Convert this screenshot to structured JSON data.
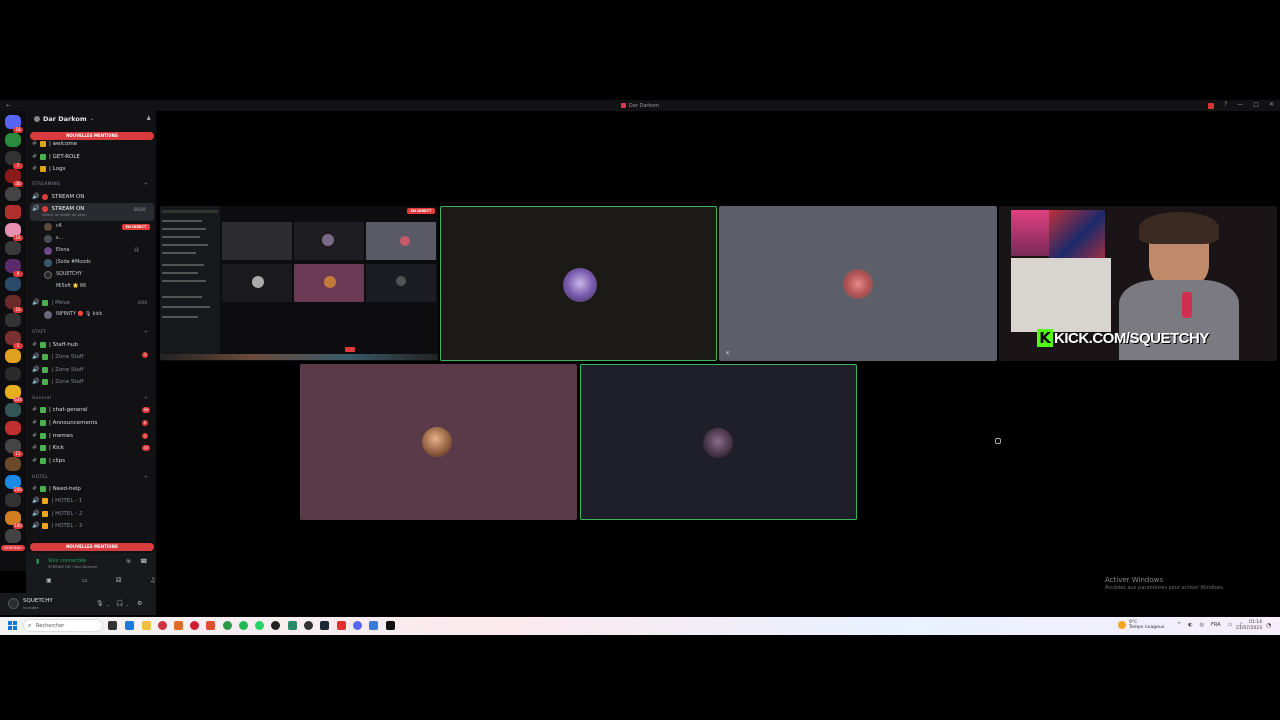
{
  "titlebar": {
    "back_glyph": "←",
    "title": "Dar Darkom",
    "controls": [
      "?",
      "—",
      "□",
      "✕"
    ]
  },
  "sidebar": {
    "server_name": "Dar Darkom",
    "mention_pill_top": "NOUVELLES MENTIONS",
    "mention_pill_bottom": "NOUVELLES MENTIONS",
    "channels_top": [
      {
        "name": "| welcome"
      },
      {
        "name": "| GET-ROLE"
      },
      {
        "name": "| Logs"
      }
    ],
    "category_streaming": "STREAMING",
    "stream_channels": [
      {
        "name": "STREAM ON"
      },
      {
        "name": "STREAM ON",
        "subtitle": "Définir un statut de salon",
        "count": "05/10"
      }
    ],
    "voice_users": [
      {
        "name": "c4",
        "tag": "EN DIRECT"
      },
      {
        "name": "s..."
      },
      {
        "name": "Elena"
      },
      {
        "name": "|Soda #Moods"
      },
      {
        "name": "SQUETCHY"
      },
      {
        "name": "Mi5oft 🌟 66"
      }
    ],
    "channels_mid": [
      {
        "name": "| Move",
        "count": "0/00"
      },
      {
        "name": "INFINITY 🔴 🎙 kick"
      }
    ],
    "category_staff": "STAFF",
    "staff_channels": [
      {
        "name": "| Staff-hub",
        "badge": "3"
      },
      {
        "name": "| Zone Staff"
      },
      {
        "name": "| Zone Staff"
      },
      {
        "name": "| Zone Staff"
      }
    ],
    "category_general": "General",
    "general_channels": [
      {
        "name": "| chat-general",
        "badge": "99"
      },
      {
        "name": "| Announcements",
        "badge": "5"
      },
      {
        "name": "| memes",
        "badge": "1"
      },
      {
        "name": "| Kick",
        "badge": "47"
      },
      {
        "name": "| clips"
      }
    ],
    "category_hotel": "HOTEL",
    "hotel_channels": [
      {
        "name": "| Need-help"
      },
      {
        "name": "| HOTEL - 1"
      },
      {
        "name": "| HOTEL - 2"
      },
      {
        "name": "| HOTEL - 3"
      }
    ]
  },
  "voice_panel": {
    "status": "Voix connectée",
    "channel": "STREAM ON / Dar Darkom"
  },
  "user_panel": {
    "username": "SQUETCHY",
    "status": "Invisible"
  },
  "rail": {
    "badges": [
      "18",
      "7",
      "30",
      "1",
      "14",
      "12",
      "9",
      "21",
      "10",
      "36",
      "5",
      "8",
      "624",
      "3",
      "16",
      "18",
      "11",
      "73",
      "6",
      "23",
      "15",
      "266",
      "3",
      "62",
      "100",
      "54",
      "2",
      "5"
    ],
    "new_label": "NOUVEAU"
  },
  "stage": {
    "live_label": "EN DIRECT",
    "kick_letter": "K",
    "kick_text": "KICK.COM/SQUETCHY"
  },
  "watermark": {
    "title": "Activer Windows",
    "subtitle": "Accédez aux paramètres pour activer Windows."
  },
  "taskbar": {
    "search_placeholder": "Rechercher",
    "weather_temp": "9°C",
    "weather_desc": "Temps nuageux",
    "tray_lang": "FRA",
    "time": "01:14",
    "date": "21/07/2023"
  },
  "colors": {
    "accent_red": "#e03c3c",
    "speaking_green": "#3fb55f",
    "kick_green": "#53fc18",
    "discord_bg": "#121214"
  }
}
